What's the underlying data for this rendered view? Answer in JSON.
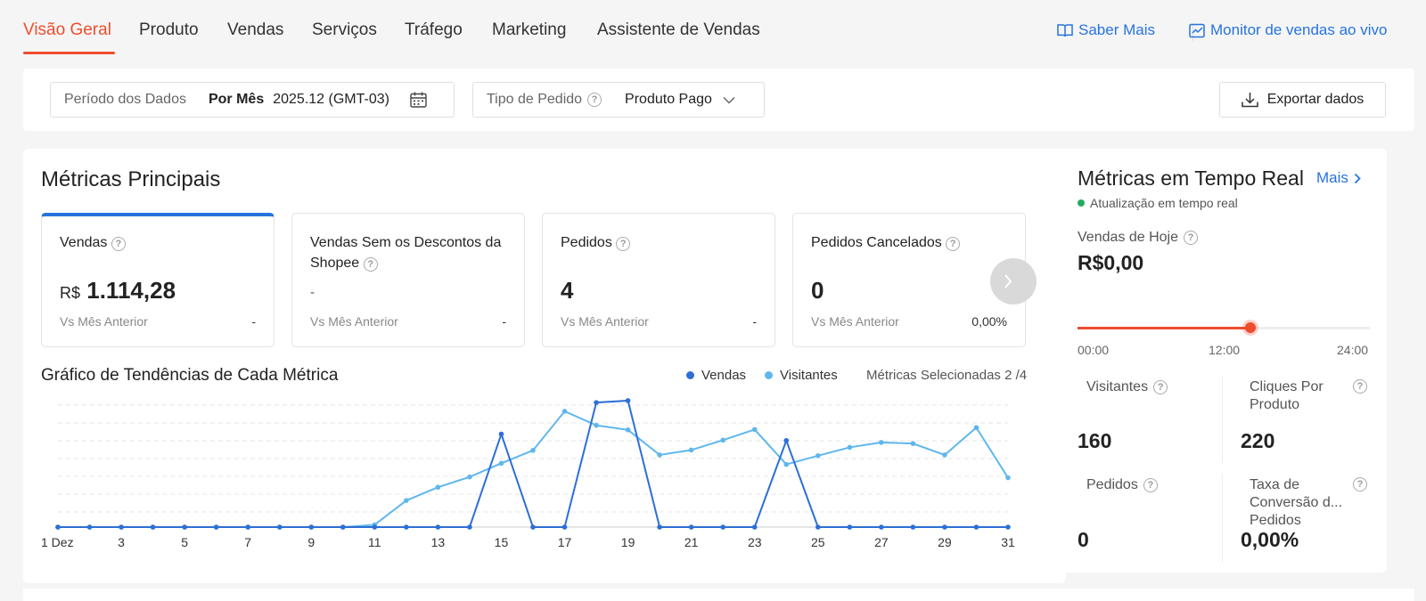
{
  "nav": {
    "tabs": [
      {
        "label": "Visão Geral",
        "active": true
      },
      {
        "label": "Produto"
      },
      {
        "label": "Vendas"
      },
      {
        "label": "Serviços"
      },
      {
        "label": "Tráfego"
      },
      {
        "label": "Marketing"
      },
      {
        "label": "Assistente de Vendas"
      }
    ],
    "learn_more": "Saber Mais",
    "live_monitor": "Monitor de vendas ao vivo"
  },
  "filters": {
    "period_label": "Período dos Dados",
    "period_mode": "Por Mês",
    "period_value": "2025.12 (GMT-03)",
    "order_type_label": "Tipo de Pedido",
    "order_type_value": "Produto Pago",
    "export_label": "Exportar dados"
  },
  "main": {
    "title": "Métricas Principais",
    "metrics": [
      {
        "title": "Vendas",
        "currency": "R$",
        "value": "1.114,28",
        "compare_label": "Vs Mês Anterior",
        "compare_value": "-"
      },
      {
        "title": "Vendas Sem os Descontos da Shopee",
        "value": "-",
        "compare_label": "Vs Mês Anterior",
        "compare_value": "-"
      },
      {
        "title": "Pedidos",
        "value": "4",
        "compare_label": "Vs Mês Anterior",
        "compare_value": "-"
      },
      {
        "title": "Pedidos Cancelados",
        "value": "0",
        "compare_label": "Vs Mês Anterior",
        "compare_value": "0,00%"
      }
    ],
    "chart_title": "Gráfico de Tendências de Cada Métrica",
    "selected_metrics": "Métricas Selecionadas 2 /4"
  },
  "chart_data": {
    "type": "line",
    "x": [
      1,
      2,
      3,
      4,
      5,
      6,
      7,
      8,
      9,
      10,
      11,
      12,
      13,
      14,
      15,
      16,
      17,
      18,
      19,
      20,
      21,
      22,
      23,
      24,
      25,
      26,
      27,
      28,
      29,
      30,
      31
    ],
    "x_tick_labels": [
      "1 Dez",
      "3",
      "5",
      "7",
      "9",
      "11",
      "13",
      "15",
      "17",
      "19",
      "21",
      "23",
      "25",
      "27",
      "29",
      "31"
    ],
    "series": [
      {
        "name": "Vendas",
        "color": "#2d6fd6",
        "values": [
          0,
          0,
          0,
          0,
          0,
          0,
          0,
          0,
          0,
          0,
          0,
          0,
          0,
          0,
          245,
          0,
          0,
          328,
          333,
          0,
          0,
          0,
          0,
          228,
          0,
          0,
          0,
          0,
          0,
          0,
          0
        ]
      },
      {
        "name": "Visitantes",
        "color": "#5fb7ec",
        "values": [
          0,
          0,
          0,
          0,
          0,
          0,
          0,
          0,
          0,
          0,
          6,
          70,
          105,
          132,
          168,
          202,
          305,
          268,
          256,
          190,
          203,
          229,
          257,
          165,
          188,
          210,
          223,
          220,
          190,
          262,
          130
        ]
      }
    ],
    "grid": true,
    "legend": "top-right"
  },
  "realtime": {
    "title": "Métricas em Tempo Real",
    "more": "Mais",
    "live_label": "Atualização em tempo real",
    "today_sales_label": "Vendas de Hoje",
    "today_sales_value": "R$0,00",
    "timeline_progress": 0.59,
    "timeline_ticks": [
      "00:00",
      "12:00",
      "24:00"
    ],
    "visitors_label": "Visitantes",
    "visitors_value": "160",
    "clicks_label_1": "Cliques Por",
    "clicks_label_2": "Produto",
    "clicks_value": "220",
    "orders_label": "Pedidos",
    "orders_value": "0",
    "conv_label_1": "Taxa de",
    "conv_label_2": "Conversão d...",
    "conv_label_3": "Pedidos",
    "conv_value": "0,00%"
  }
}
